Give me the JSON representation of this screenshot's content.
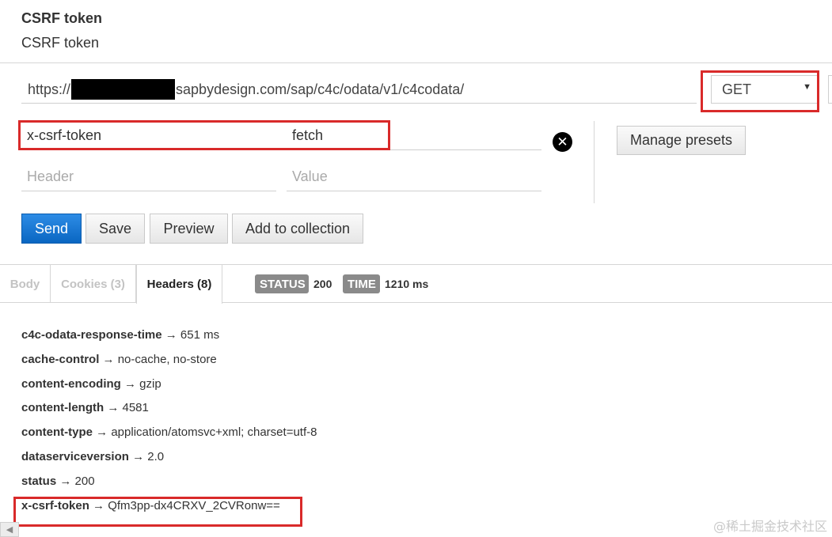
{
  "header": {
    "title": "CSRF token",
    "subtitle": "CSRF token"
  },
  "request": {
    "url_prefix": "https://",
    "url_suffix": "sapbydesign.com/sap/c4c/odata/v1/c4codata/",
    "method": "GET",
    "headers": [
      {
        "key": "x-csrf-token",
        "value": "fetch"
      }
    ],
    "new_header_placeholder": "Header",
    "new_value_placeholder": "Value",
    "manage_presets_label": "Manage presets"
  },
  "buttons": {
    "send": "Send",
    "save": "Save",
    "preview": "Preview",
    "add_to_collection": "Add to collection"
  },
  "response": {
    "tabs": [
      "Body",
      "Cookies (3)",
      "Headers (8)"
    ],
    "active_tab": "Headers (8)",
    "status_label": "STATUS",
    "status_value": "200",
    "time_label": "TIME",
    "time_value": "1210 ms",
    "headers": [
      {
        "key": "c4c-odata-response-time",
        "value": "651 ms"
      },
      {
        "key": "cache-control",
        "value": "no-cache, no-store"
      },
      {
        "key": "content-encoding",
        "value": "gzip"
      },
      {
        "key": "content-length",
        "value": "4581"
      },
      {
        "key": "content-type",
        "value": "application/atomsvc+xml; charset=utf-8"
      },
      {
        "key": "dataserviceversion",
        "value": "2.0"
      },
      {
        "key": "status",
        "value": "200"
      },
      {
        "key": "x-csrf-token",
        "value": "Qfm3pp-dx4CRXV_2CVRonw=="
      }
    ],
    "arrow": "→"
  },
  "watermark": "@稀土掘金技术社区",
  "colors": {
    "highlight": "#d92a2a",
    "send_button": "#0a66c2",
    "badge": "#8a8a8a"
  }
}
